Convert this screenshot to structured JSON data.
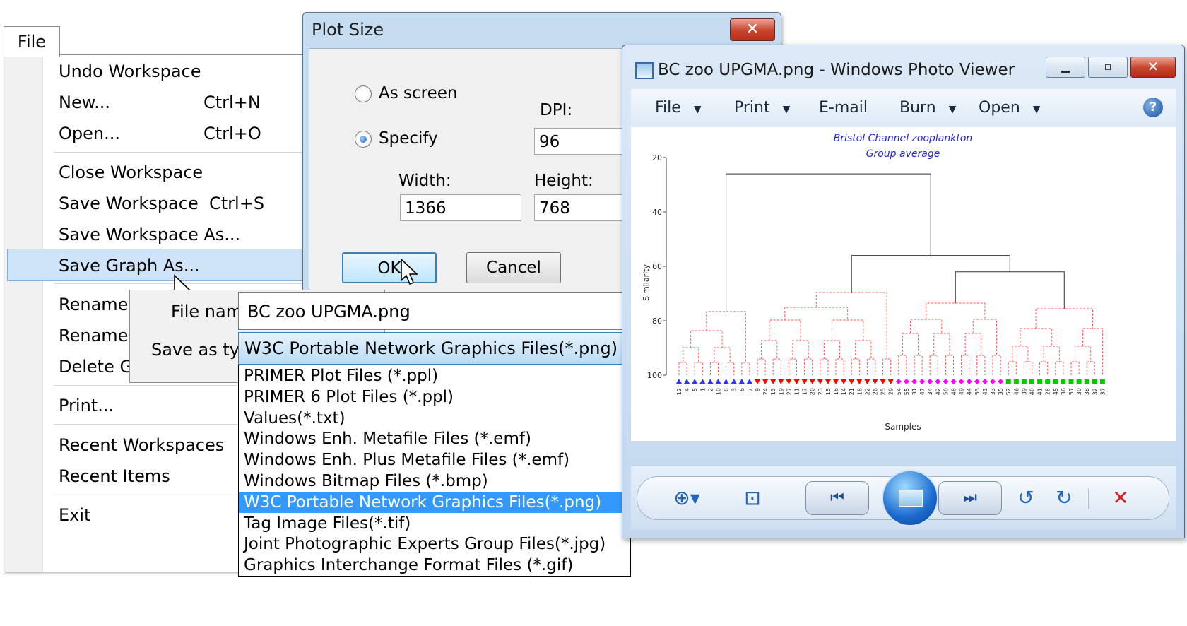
{
  "file_menu": {
    "tab_label": "File",
    "items": [
      {
        "label": "Undo Workspace",
        "shortcut": ""
      },
      {
        "label": "New...",
        "shortcut": "Ctrl+N"
      },
      {
        "label": "Open...",
        "shortcut": "Ctrl+O"
      },
      {
        "label": "Close Workspace",
        "shortcut": ""
      },
      {
        "label": "Save Workspace",
        "shortcut": "Ctrl+S"
      },
      {
        "label": "Save Workspace As...",
        "shortcut": ""
      },
      {
        "label": "Save Graph As...",
        "shortcut": ""
      },
      {
        "label": "Rename W",
        "shortcut": ""
      },
      {
        "label": "Rename C",
        "shortcut": ""
      },
      {
        "label": "Delete Gra",
        "shortcut": ""
      },
      {
        "label": "Print...",
        "shortcut": ""
      },
      {
        "label": "Recent Workspaces",
        "shortcut": ""
      },
      {
        "label": "Recent Items",
        "shortcut": ""
      },
      {
        "label": "Exit",
        "shortcut": ""
      }
    ]
  },
  "plot_size_dialog": {
    "title": "Plot Size",
    "close_glyph": "✕",
    "as_screen_label": "As screen",
    "specify_label": "Specify",
    "dpi_label": "DPI:",
    "dpi_value": "96",
    "width_label": "Width:",
    "width_value": "1366",
    "height_label": "Height:",
    "height_value": "768",
    "ok_label": "OK",
    "cancel_label": "Cancel"
  },
  "save_dialog": {
    "file_name_label": "File name:",
    "file_name_value": "BC zoo UPGMA.png",
    "save_as_type_label": "Save as type:",
    "save_as_type_value": "W3C Portable Network Graphics Files(*.png)",
    "type_options": [
      "PRIMER Plot Files (*.ppl)",
      "PRIMER 6 Plot Files (*.ppl)",
      "Values(*.txt)",
      "Windows Enh. Metafile Files (*.emf)",
      "Windows Enh. Plus Metafile Files (*.emf)",
      "Windows Bitmap Files (*.bmp)",
      "W3C Portable Network Graphics Files(*.png)",
      "Tag Image Files(*.tif)",
      "Joint Photographic Experts Group Files(*.jpg)",
      "Graphics Interchange Format Files (*.gif)"
    ],
    "selected_index": 6
  },
  "photo_viewer": {
    "title": "BC zoo UPGMA.png - Windows Photo Viewer",
    "menu": [
      {
        "label": "File",
        "has_arrow": true
      },
      {
        "label": "Print",
        "has_arrow": true
      },
      {
        "label": "E-mail",
        "has_arrow": false
      },
      {
        "label": "Burn",
        "has_arrow": true
      },
      {
        "label": "Open",
        "has_arrow": true
      }
    ],
    "help_glyph": "?",
    "window_buttons": {
      "minimize": "▁",
      "maximize": "▫",
      "close": "✕"
    },
    "controls": {
      "zoom": "⊕▾",
      "fit": "⊡",
      "prev": "⏮",
      "next": "⏭",
      "rotate_ccw": "↺",
      "rotate_cw": "↻",
      "delete": "✕"
    }
  },
  "dendrogram": {
    "title": "Bristol Channel zooplankton",
    "subtitle": "Group average",
    "ylabel": "Similarity",
    "xlabel": "Samples",
    "y_ticks": [
      "20",
      "40",
      "60",
      "80",
      "100"
    ],
    "sample_labels": [
      "12",
      "4",
      "5",
      "1",
      "2",
      "10",
      "8",
      "3",
      "6",
      "7",
      "9",
      "24",
      "13",
      "19",
      "27",
      "11",
      "17",
      "20",
      "23",
      "15",
      "16",
      "14",
      "21",
      "18",
      "22",
      "26",
      "25",
      "29",
      "54",
      "55",
      "31",
      "47",
      "34",
      "42",
      "50",
      "48",
      "49",
      "44",
      "53",
      "43",
      "33",
      "35",
      "52",
      "46",
      "39",
      "40",
      "41",
      "28",
      "45",
      "36",
      "57",
      "30",
      "38",
      "32",
      "37"
    ],
    "marker_groups": [
      {
        "shape": "triangle-up",
        "color": "#3333ff",
        "count": 10
      },
      {
        "shape": "triangle-down",
        "color": "#ff0000",
        "count": 18
      },
      {
        "shape": "diamond",
        "color": "#ff00ff",
        "count": 14
      },
      {
        "shape": "square",
        "color": "#00cc00",
        "count": 13
      }
    ],
    "colors": {
      "title": "#2222dd",
      "branch_dashed": "#ff5555",
      "branch_solid": "#333333"
    }
  }
}
